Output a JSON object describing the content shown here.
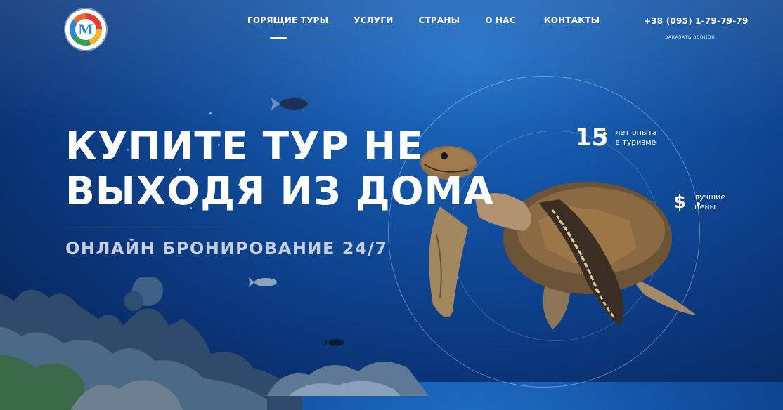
{
  "header": {
    "nav": [
      {
        "label": "ГОРЯЩИЕ ТУРЫ",
        "active": true
      },
      {
        "label": "УСЛУГИ",
        "active": false
      },
      {
        "label": "СТРАНЫ",
        "active": false
      },
      {
        "label": "О НАС",
        "active": false
      },
      {
        "label": "КОНТАКТЫ",
        "active": false
      }
    ],
    "phone": "+38 (095) 1-79-79-79",
    "callback": "заказать звонок"
  },
  "hero": {
    "headline_line1": "КУПИТЕ ТУР НЕ",
    "headline_line2": "ВЫХОДЯ ИЗ ДОМА",
    "subheadline": "ОНЛАЙН БРОНИРОВАНИЕ 24/7"
  },
  "stats": {
    "years_value": "15",
    "years_label_line1": "лет опыта",
    "years_label_line2": "в туризме",
    "price_symbol": "$",
    "price_label_line1": "лучшие",
    "price_label_line2": "цены"
  },
  "colors": {
    "background": "#114f9f",
    "text": "#ffffff",
    "subheadline": "#c6cfe0"
  },
  "icons": {
    "logo": "compass-logo-icon",
    "turtle": "sea-turtle-illustration",
    "fish": "fish-icon",
    "reef": "coral-reef-illustration"
  }
}
